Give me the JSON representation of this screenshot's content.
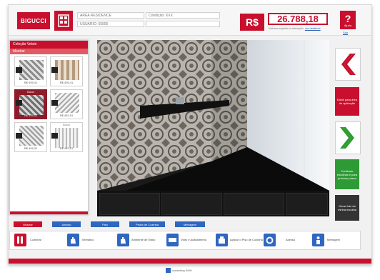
{
  "header": {
    "brand": "BIGUCCI",
    "field1": "AREA RESIDENCE",
    "field2": "Condição: XXX",
    "field3": "USUARIO: 55555",
    "currency": "R$",
    "price": "26.788,18",
    "price_note": "Valores sujeitos a alteração",
    "price_link": "ver detalhes",
    "help_label": "Ajuda",
    "help_link": "Sair"
  },
  "catalog": {
    "title": "Coleção Vetsin",
    "subtitle": "Mostrar",
    "tiles": [
      {
        "price": "R$ 495,41",
        "top": ""
      },
      {
        "price": "R$ 495,41",
        "top": ""
      },
      {
        "price": "R$ 495,41",
        "top": "Bucci"
      },
      {
        "price": "R$ 462,51",
        "top": ""
      },
      {
        "price": "R$ 495,31",
        "top": ""
      },
      {
        "price": "R$ 462,51",
        "top": "Bucci"
      }
    ]
  },
  "side": {
    "photo_label": "Exibir para área de aplicação",
    "continue_label": "Continuar escolhas e para próximo passo",
    "finish_label": "Gerar foto da minha escolha"
  },
  "tabs": [
    "Mostrar",
    "Azulejo",
    "Piso",
    "Pedra de Cozinha",
    "Metragem"
  ],
  "toolbar": {
    "items": [
      "Cozinhar",
      "Interativo",
      "Ambiente de Estilo",
      "Vidro e Acabamento",
      "Aplicar o Piso de Cozinha",
      "Acesso",
      "Metragem"
    ]
  },
  "footer": "marketing SMH"
}
